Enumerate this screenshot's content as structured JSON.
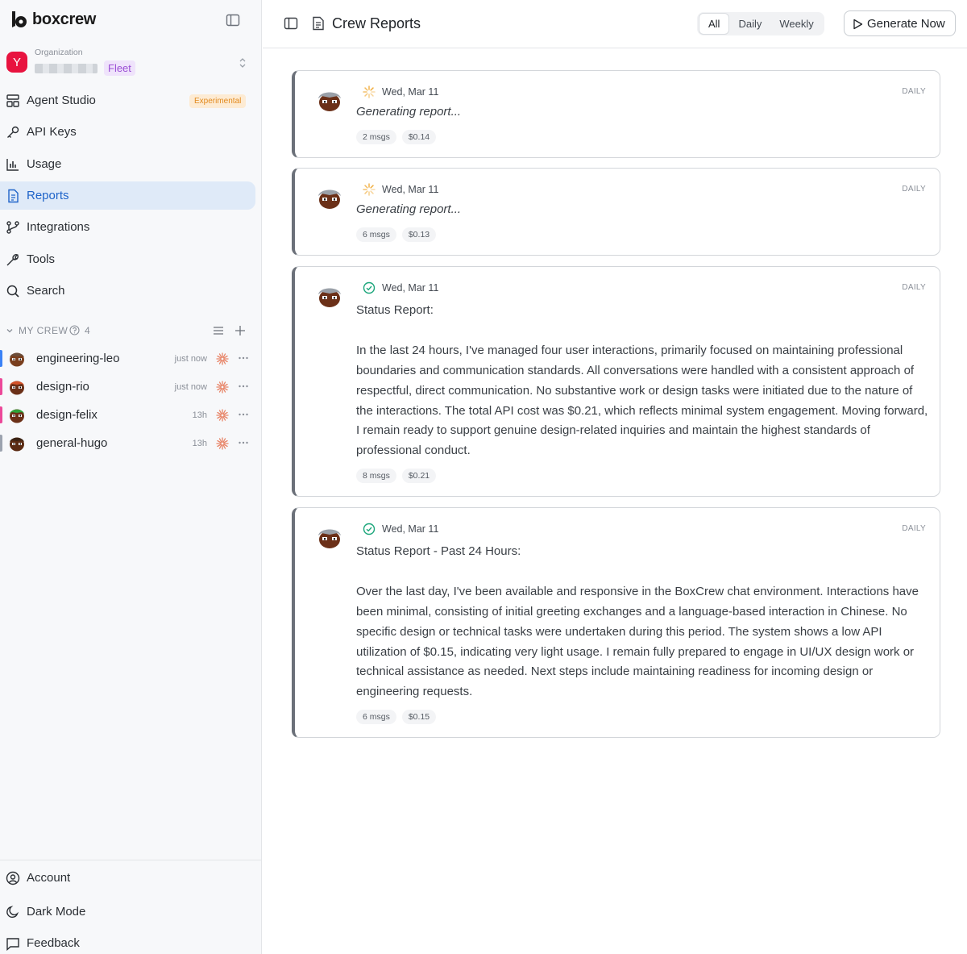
{
  "brand": {
    "name": "boxcrew"
  },
  "org": {
    "label": "Organization",
    "avatar_letter": "Y",
    "badge": "Fleet"
  },
  "nav": {
    "items": [
      {
        "label": "Agent Studio",
        "badge": "Experimental",
        "icon": "layout-icon"
      },
      {
        "label": "API Keys",
        "icon": "key-icon"
      },
      {
        "label": "Usage",
        "icon": "bar-chart-icon"
      },
      {
        "label": "Reports",
        "icon": "document-icon",
        "active": true
      },
      {
        "label": "Integrations",
        "icon": "git-branch-icon"
      },
      {
        "label": "Tools",
        "icon": "wrench-icon"
      },
      {
        "label": "Search",
        "icon": "search-icon"
      }
    ]
  },
  "crew": {
    "title": "MY CREW",
    "count": "4",
    "members": [
      {
        "name": "engineering-leo",
        "time": "just now",
        "color": "#3b82f6"
      },
      {
        "name": "design-rio",
        "time": "just now",
        "color": "#ec4899"
      },
      {
        "name": "design-felix",
        "time": "13h",
        "color": "#ec4899"
      },
      {
        "name": "general-hugo",
        "time": "13h",
        "color": "#9ca3af"
      }
    ]
  },
  "footer": {
    "account": "Account",
    "dark_mode": "Dark Mode",
    "feedback": "Feedback"
  },
  "header": {
    "title": "Crew Reports",
    "generate_label": "Generate Now"
  },
  "filters": [
    "All",
    "Daily",
    "Weekly"
  ],
  "active_filter": "All",
  "reports": [
    {
      "date": "Wed, Mar 11",
      "kind": "DAILY",
      "status": "generating",
      "text": "Generating report...",
      "msgs": "2 msgs",
      "cost": "$0.14"
    },
    {
      "date": "Wed, Mar 11",
      "kind": "DAILY",
      "status": "generating",
      "text": "Generating report...",
      "msgs": "6 msgs",
      "cost": "$0.13"
    },
    {
      "date": "Wed, Mar 11",
      "kind": "DAILY",
      "status": "complete",
      "text": "Status Report:\n\nIn the last 24 hours, I've managed four user interactions, primarily focused on maintaining professional boundaries and communication standards. All conversations were handled with a consistent approach of respectful, direct communication. No substantive work or design tasks were initiated due to the nature of the interactions. The total API cost was $0.21, which reflects minimal system engagement. Moving forward, I remain ready to support genuine design-related inquiries and maintain the highest standards of professional conduct.",
      "msgs": "8 msgs",
      "cost": "$0.21"
    },
    {
      "date": "Wed, Mar 11",
      "kind": "DAILY",
      "status": "complete",
      "text": "Status Report - Past 24 Hours:\n\nOver the last day, I've been available and responsive in the BoxCrew chat environment. Interactions have been minimal, consisting of initial greeting exchanges and a language-based interaction in Chinese. No specific design or technical tasks were undertaken during this period. The system shows a low API utilization of $0.15, indicating very light usage. I remain fully prepared to engage in UI/UX design work or technical assistance as needed. Next steps include maintaining readiness for incoming design or engineering requests.",
      "msgs": "6 msgs",
      "cost": "$0.15"
    }
  ]
}
